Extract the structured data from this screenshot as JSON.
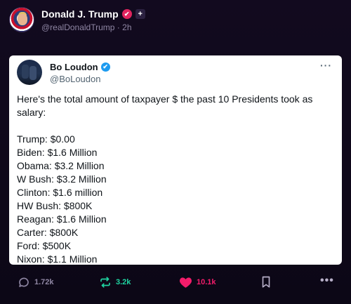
{
  "post": {
    "author_name": "Donald J. Trump",
    "handle": "@realDonaldTrump",
    "separator": "·",
    "time": "2h",
    "badge_glyph": "✔",
    "plus_glyph": "+"
  },
  "quoted": {
    "author_name": "Bo Loudon",
    "handle": "@BoLoudon",
    "verified_glyph": "✔",
    "more_glyph": "···",
    "intro": "Here's the total amount of taxpayer $ the past 10 Presidents took as salary:",
    "lines": [
      "Trump: $0.00",
      "Biden: $1.6 Million",
      "Obama: $3.2 Million",
      "W Bush: $3.2 Million",
      "Clinton: $1.6 million",
      "HW Bush: $800K",
      "Reagan: $1.6 Million",
      "Carter: $800K",
      "Ford: $500K",
      "Nixon: $1.1 Million"
    ]
  },
  "actions": {
    "replies": "1.72k",
    "reposts": "3.2k",
    "likes": "10.1k",
    "menu_glyph": "•••"
  },
  "colors": {
    "background": "#0f0a1a",
    "repost": "#1fd3a0",
    "like": "#f31c6a",
    "verified": "#1d9bf0"
  },
  "icons": [
    "reply-icon",
    "repost-icon",
    "heart-icon",
    "bookmark-icon",
    "more-icon"
  ]
}
